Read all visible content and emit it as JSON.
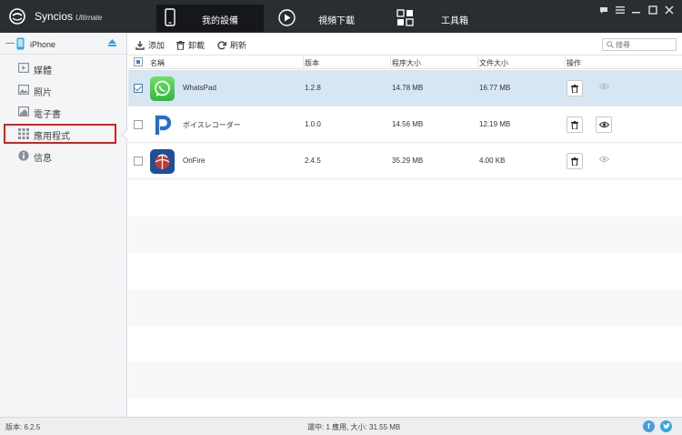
{
  "app": {
    "brand": "Syncios",
    "edition": "Ultimate"
  },
  "tabs": [
    {
      "label": "我的設備",
      "icon": "phone-icon",
      "active": true
    },
    {
      "label": "視頻下載",
      "icon": "play-icon",
      "active": false
    },
    {
      "label": "工具箱",
      "icon": "toolbox-icon",
      "active": false
    }
  ],
  "device": {
    "name": "iPhone"
  },
  "sidebar": {
    "items": [
      {
        "label": "媒體",
        "icon": "media-icon"
      },
      {
        "label": "照片",
        "icon": "photo-icon"
      },
      {
        "label": "電子書",
        "icon": "ebook-icon"
      },
      {
        "label": "應用程式",
        "icon": "apps-grid-icon",
        "highlighted": true
      },
      {
        "label": "信息",
        "icon": "info-icon"
      }
    ]
  },
  "toolbar": {
    "add_label": "添加",
    "uninstall_label": "卸載",
    "refresh_label": "刷新"
  },
  "search": {
    "placeholder": "搜尋"
  },
  "table": {
    "columns": [
      "名稱",
      "版本",
      "程序大小",
      "文件大小",
      "操作"
    ],
    "rows": [
      {
        "name": "WhatsPad",
        "version": "1.2.8",
        "app_size": "14.78 MB",
        "doc_size": "16.77 MB",
        "checked": true,
        "icon": "whatspad-app-icon"
      },
      {
        "name": "ボイスレコーダー",
        "version": "1.0.0",
        "app_size": "14.56 MB",
        "doc_size": "12.19 MB",
        "checked": false,
        "icon": "voice-recorder-app-icon"
      },
      {
        "name": "OnFire",
        "version": "2.4.5",
        "app_size": "35.29 MB",
        "doc_size": "4.00 KB",
        "checked": false,
        "icon": "onfire-app-icon"
      }
    ]
  },
  "status": {
    "version": "版本: 6.2.5",
    "selection": "選中: 1 應用, 大小: 31.55 MB"
  },
  "colors": {
    "header_bg": "#2a2e32",
    "selected_row": "#d7e6f3",
    "highlight_border": "#d62020",
    "facebook": "#4a9ee0",
    "twitter": "#30a8e6"
  }
}
